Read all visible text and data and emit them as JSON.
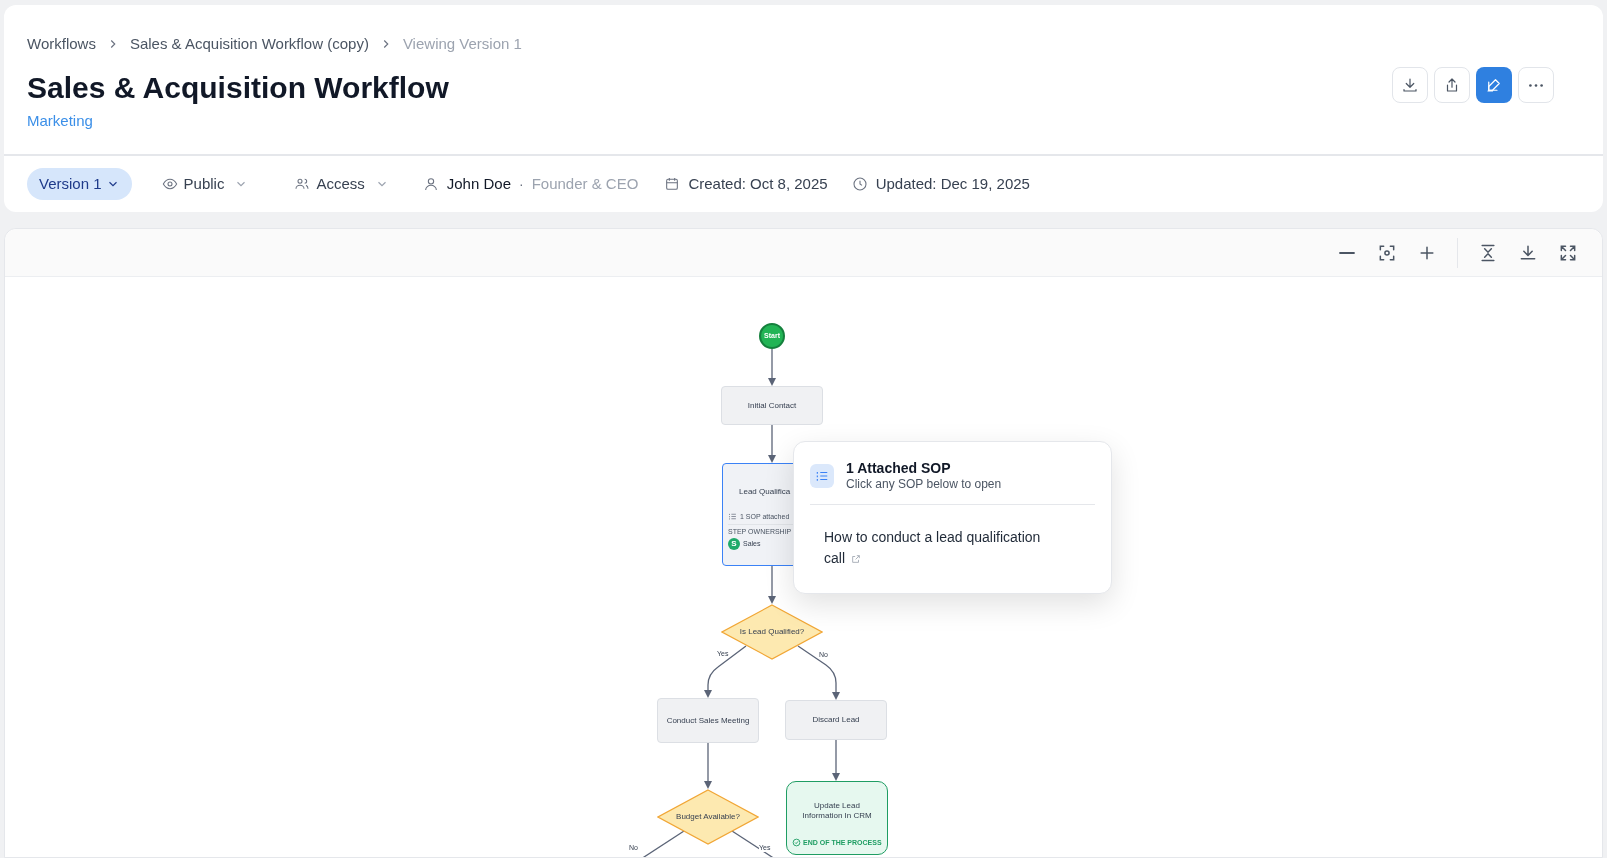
{
  "breadcrumbs": [
    {
      "label": "Workflows",
      "current": false
    },
    {
      "label": "Sales & Acquisition Workflow (copy)",
      "current": false
    },
    {
      "label": "Viewing Version 1",
      "current": true
    }
  ],
  "title": "Sales & Acquisition Workflow",
  "category": "Marketing",
  "actions": [
    {
      "kind": "download",
      "primary": false
    },
    {
      "kind": "share",
      "primary": false
    },
    {
      "kind": "edit",
      "primary": true
    },
    {
      "kind": "more",
      "primary": false
    }
  ],
  "meta": {
    "version": "Version 1",
    "visibility": "Public",
    "access": "Access",
    "owner": "John Doe",
    "separator": "·",
    "owner_role": "Founder & CEO",
    "created": "Created: Oct 8, 2025",
    "updated": "Updated: Dec 19, 2025"
  },
  "canvas_tools": [
    {
      "kind": "zoom-out"
    },
    {
      "kind": "fit"
    },
    {
      "kind": "zoom-in"
    },
    {
      "kind": "collapse"
    },
    {
      "kind": "download"
    },
    {
      "kind": "fullscreen"
    }
  ],
  "diagram": {
    "nodes": [
      {
        "kind": "start",
        "label": "Start"
      },
      {
        "kind": "process",
        "label": "Initial Contact",
        "selected": false
      },
      {
        "kind": "process",
        "label": "Lead Qualifica",
        "selected": true,
        "sop": "1 SOP attached",
        "owner_heading": "STEP OWNERSHIP",
        "owner_initial": "S",
        "owner": "Sales"
      },
      {
        "kind": "decision",
        "label": "Is Lead Qualified?",
        "branches": [
          {
            "label": "Yes"
          },
          {
            "label": "No"
          }
        ]
      },
      {
        "kind": "process",
        "label": "Conduct Sales Meeting",
        "selected": false
      },
      {
        "kind": "process",
        "label": "Discard Lead",
        "selected": false
      },
      {
        "kind": "decision",
        "label": "Budget Available?",
        "branches": [
          {
            "label": "No"
          },
          {
            "label": "Yes"
          }
        ]
      },
      {
        "kind": "end",
        "label": "Update Lead Information In CRM",
        "badge": "END OF THE PROCESS"
      }
    ]
  },
  "sop_popover": {
    "title": "1 Attached SOP",
    "subtitle": "Click any SOP below to open",
    "items": [
      "How to conduct a lead qualification call"
    ]
  }
}
